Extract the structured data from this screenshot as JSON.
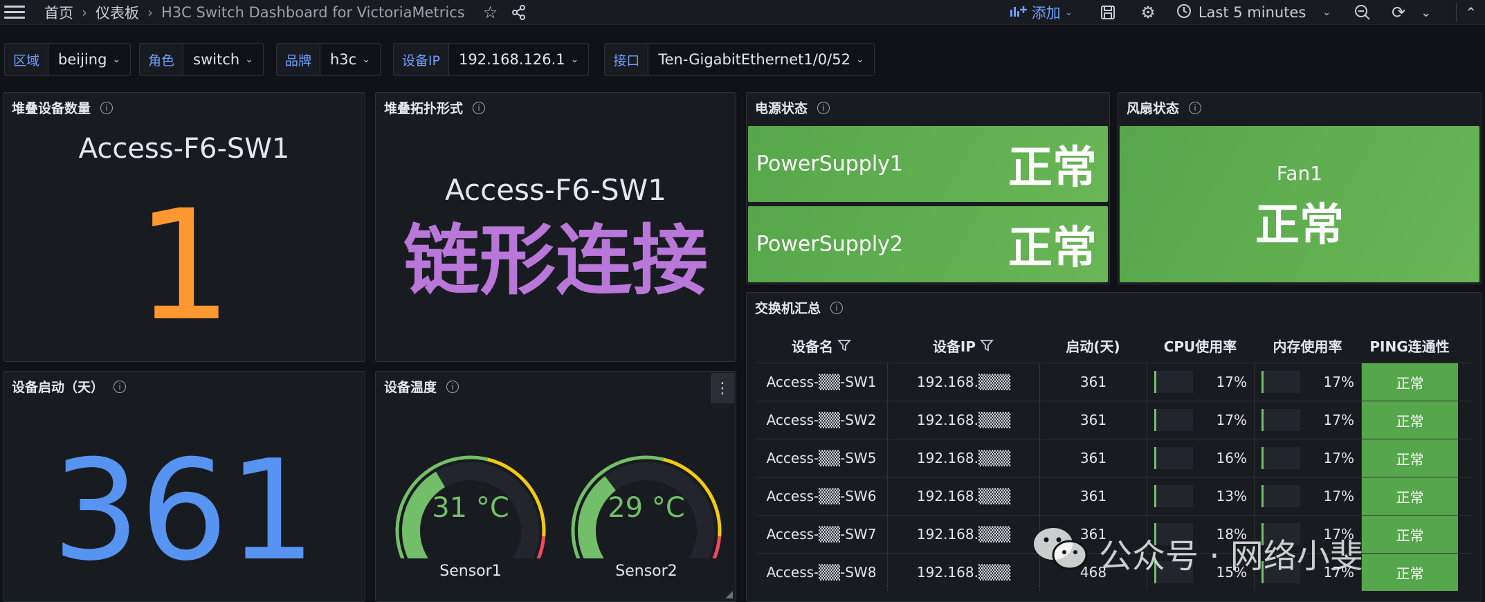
{
  "nav": {
    "home": "首页",
    "dashboards": "仪表板",
    "title": "H3C Switch Dashboard for VictoriaMetrics",
    "add_label": "添加",
    "time_range": "Last 5 minutes"
  },
  "variables": [
    {
      "label": "区域",
      "value": "beijing"
    },
    {
      "label": "角色",
      "value": "switch"
    },
    {
      "label": "品牌",
      "value": "h3c"
    },
    {
      "label": "设备IP",
      "value": "192.168.126.1"
    },
    {
      "label": "接口",
      "value": "Ten-GigabitEthernet1/0/52"
    }
  ],
  "panels": {
    "stack_count": {
      "title": "堆叠设备数量",
      "device": "Access-F6-SW1",
      "value": "1",
      "color": "#ff9830"
    },
    "stack_topology": {
      "title": "堆叠拓扑形式",
      "device": "Access-F6-SW1",
      "value": "链形连接",
      "color": "#b877d9"
    },
    "power": {
      "title": "电源状态",
      "items": [
        {
          "name": "PowerSupply1",
          "status": "正常"
        },
        {
          "name": "PowerSupply2",
          "status": "正常"
        }
      ]
    },
    "fan": {
      "title": "风扇状态",
      "name": "Fan1",
      "status": "正常"
    },
    "uptime": {
      "title": "设备启动（天）",
      "value": "361",
      "color": "#5794f2"
    },
    "temperature": {
      "title": "设备温度",
      "sensors": [
        {
          "name": "Sensor1",
          "label": "31 °C",
          "value": 31
        },
        {
          "name": "Sensor2",
          "label": "29 °C",
          "value": 29
        }
      ],
      "gauge_max": 80
    },
    "summary": {
      "title": "交换机汇总",
      "columns": [
        "设备名",
        "设备IP",
        "启动(天)",
        "CPU使用率",
        "内存使用率",
        "PING连通性"
      ],
      "rows": [
        {
          "name": "Access-▒▒-SW1",
          "ip": "192.168.▒▒▒",
          "uptime": "361",
          "cpu": "17%",
          "mem": "17%",
          "ping": "正常"
        },
        {
          "name": "Access-▒▒-SW2",
          "ip": "192.168.▒▒▒",
          "uptime": "361",
          "cpu": "17%",
          "mem": "17%",
          "ping": "正常"
        },
        {
          "name": "Access-▒▒-SW5",
          "ip": "192.168.▒▒▒",
          "uptime": "361",
          "cpu": "16%",
          "mem": "17%",
          "ping": "正常"
        },
        {
          "name": "Access-▒▒-SW6",
          "ip": "192.168.▒▒▒",
          "uptime": "361",
          "cpu": "13%",
          "mem": "17%",
          "ping": "正常"
        },
        {
          "name": "Access-▒▒-SW7",
          "ip": "192.168.▒▒▒",
          "uptime": "361",
          "cpu": "18%",
          "mem": "17%",
          "ping": "正常"
        },
        {
          "name": "Access-▒▒-SW8",
          "ip": "192.168.▒▒▒",
          "uptime": "468",
          "cpu": "15%",
          "mem": "17%",
          "ping": "正常"
        }
      ]
    }
  },
  "watermark": "公众号 · 网络小斐",
  "colors": {
    "ok_green": "#56a64b",
    "accent_blue": "#6e9fff"
  }
}
